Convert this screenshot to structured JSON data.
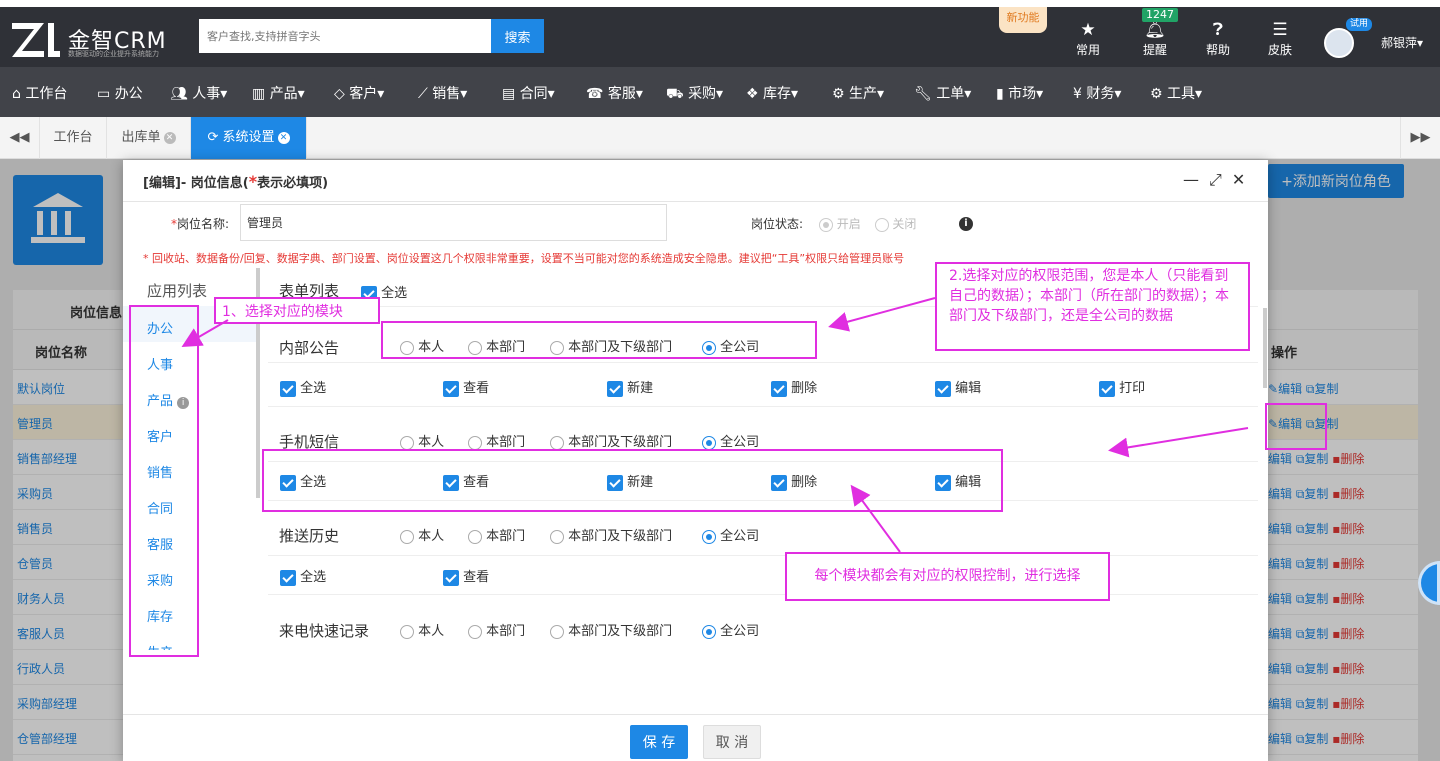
{
  "header": {
    "brand": "金智CRM",
    "slogan": "数据驱动的企业提升系统能力",
    "search_placeholder": "客户查找,支持拼音字头",
    "search_button": "搜索",
    "new_feature": "新功能",
    "icons": [
      {
        "label": "常用",
        "icon": "star-icon"
      },
      {
        "label": "提醒",
        "icon": "bell-icon"
      },
      {
        "label": "帮助",
        "icon": "help-icon"
      },
      {
        "label": "皮肤",
        "icon": "skin-icon"
      }
    ],
    "notification_count": "1247",
    "trial_badge": "试用",
    "username": "郝银萍▾"
  },
  "nav": {
    "items": [
      "工作台",
      "办公",
      "人事▾",
      "产品▾",
      "客户▾",
      "销售▾",
      "合同▾",
      "客服▾",
      "采购▾",
      "库存▾",
      "生产▾",
      "工单▾",
      "市场▾",
      "财务▾",
      "工具▾"
    ]
  },
  "tabs": {
    "items": [
      "工作台",
      "出库单",
      "系统设置"
    ]
  },
  "background": {
    "add_role_button": "+添加新岗位角色",
    "table_title": "岗位信息",
    "col_name": "岗位名称",
    "col_ops": "操作",
    "rows": [
      "默认岗位",
      "管理员",
      "销售部经理",
      "采购员",
      "销售员",
      "仓管员",
      "财务人员",
      "客服人员",
      "行政人员",
      "采购部经理",
      "仓管部经理"
    ],
    "op_edit": "编辑",
    "op_copy": "复制",
    "op_delete": "删除"
  },
  "modal": {
    "title_prefix": "[编辑]- 岗位信息(",
    "title_star": "*",
    "title_suffix": "表示必填项)",
    "position_label_star": "*",
    "position_label": "岗位名称:",
    "position_value": "管理员",
    "status_label": "岗位状态:",
    "status_on": "开启",
    "status_off": "关闭",
    "warning": "* 回收站、数据备份/回复、数据字典、部门设置、岗位设置这几个权限非常重要，设置不当可能对您的系统造成安全隐患。建议把“工具”权限只给管理员账号",
    "app_list_title": "应用列表",
    "modules": [
      "办公",
      "人事",
      "产品",
      "客户",
      "销售",
      "合同",
      "客服",
      "采购",
      "库存",
      "生产"
    ],
    "form_list_title": "表单列表",
    "select_all": "全选",
    "scopes": [
      "本人",
      "本部门",
      "本部门及下级部门",
      "全公司"
    ],
    "sections": [
      {
        "name": "内部公告",
        "perms": [
          "全选",
          "查看",
          "新建",
          "删除",
          "编辑",
          "打印"
        ]
      },
      {
        "name": "手机短信",
        "perms": [
          "全选",
          "查看",
          "新建",
          "删除",
          "编辑"
        ]
      },
      {
        "name": "推送历史",
        "perms": [
          "全选",
          "查看"
        ]
      },
      {
        "name": "来电快速记录",
        "perms": []
      }
    ],
    "save": "保 存",
    "cancel": "取 消"
  },
  "annotations": {
    "step1": "1、选择对应的模块",
    "step2": "2.选择对应的权限范围，您是本人（只能看到自己的数据）；本部门（所在部门的数据）；本部门及下级部门，还是全公司的数据",
    "step3": "每个模块都会有对应的权限控制，进行选择"
  }
}
